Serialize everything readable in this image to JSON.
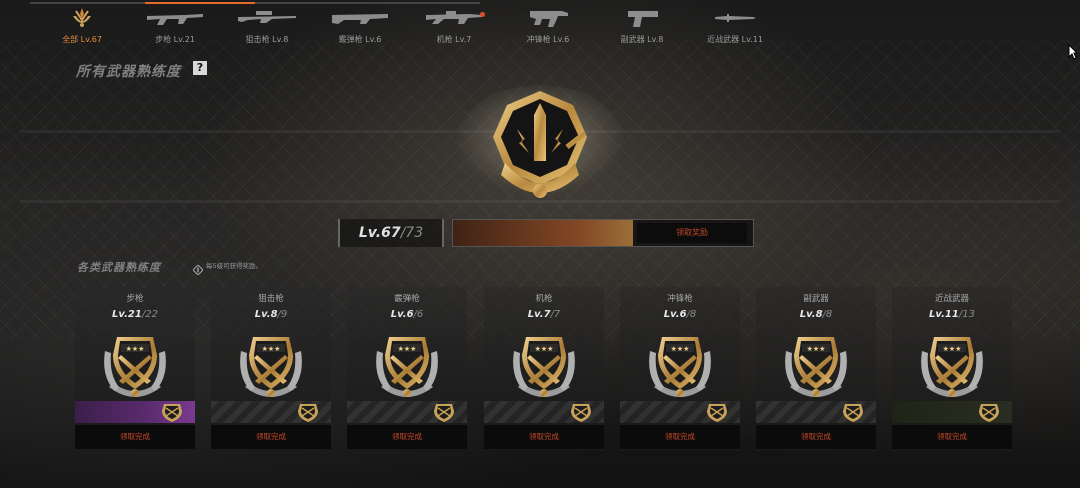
{
  "tabs": [
    {
      "label": "全部 Lv.67",
      "icon": "all-weapons-emblem-icon",
      "active": true
    },
    {
      "label": "步枪 Lv.21",
      "icon": "rifle-icon"
    },
    {
      "label": "狙击枪 Lv.8",
      "icon": "sniper-icon"
    },
    {
      "label": "霰弹枪 Lv.6",
      "icon": "shotgun-icon"
    },
    {
      "label": "机枪 Lv.7",
      "icon": "machine-gun-icon",
      "badge": true
    },
    {
      "label": "冲锋枪 Lv.6",
      "icon": "smg-icon"
    },
    {
      "label": "副武器 Lv.8",
      "icon": "pistol-icon"
    },
    {
      "label": "近战武器 Lv.11",
      "icon": "knife-icon"
    }
  ],
  "overall": {
    "title": "所有武器熟练度",
    "help": "?",
    "level": "Lv.67",
    "max": "/73",
    "progress": 0.6,
    "claim_label": "领取奖励"
  },
  "categories_section": {
    "title": "各类武器熟练度",
    "hint": "每5级可获得奖励。"
  },
  "cards": [
    {
      "title": "步枪",
      "level": "Lv.21",
      "max": "/22",
      "claim": "领取完成",
      "strip": "purple"
    },
    {
      "title": "狙击枪",
      "level": "Lv.8",
      "max": "/9",
      "claim": "领取完成",
      "strip": "gray"
    },
    {
      "title": "霰弹枪",
      "level": "Lv.6",
      "max": "/6",
      "claim": "领取完成",
      "strip": "gray"
    },
    {
      "title": "机枪",
      "level": "Lv.7",
      "max": "/7",
      "claim": "领取完成",
      "strip": "gray"
    },
    {
      "title": "冲锋枪",
      "level": "Lv.6",
      "max": "/8",
      "claim": "领取完成",
      "strip": "gray"
    },
    {
      "title": "副武器",
      "level": "Lv.8",
      "max": "/8",
      "claim": "领取完成",
      "strip": "gray"
    },
    {
      "title": "近战武器",
      "level": "Lv.11",
      "max": "/13",
      "claim": "领取完成",
      "strip": "dark"
    }
  ],
  "colors": {
    "accent": "#e88c3a",
    "gold": "#c9a25a",
    "claim_text": "#c8482a"
  }
}
